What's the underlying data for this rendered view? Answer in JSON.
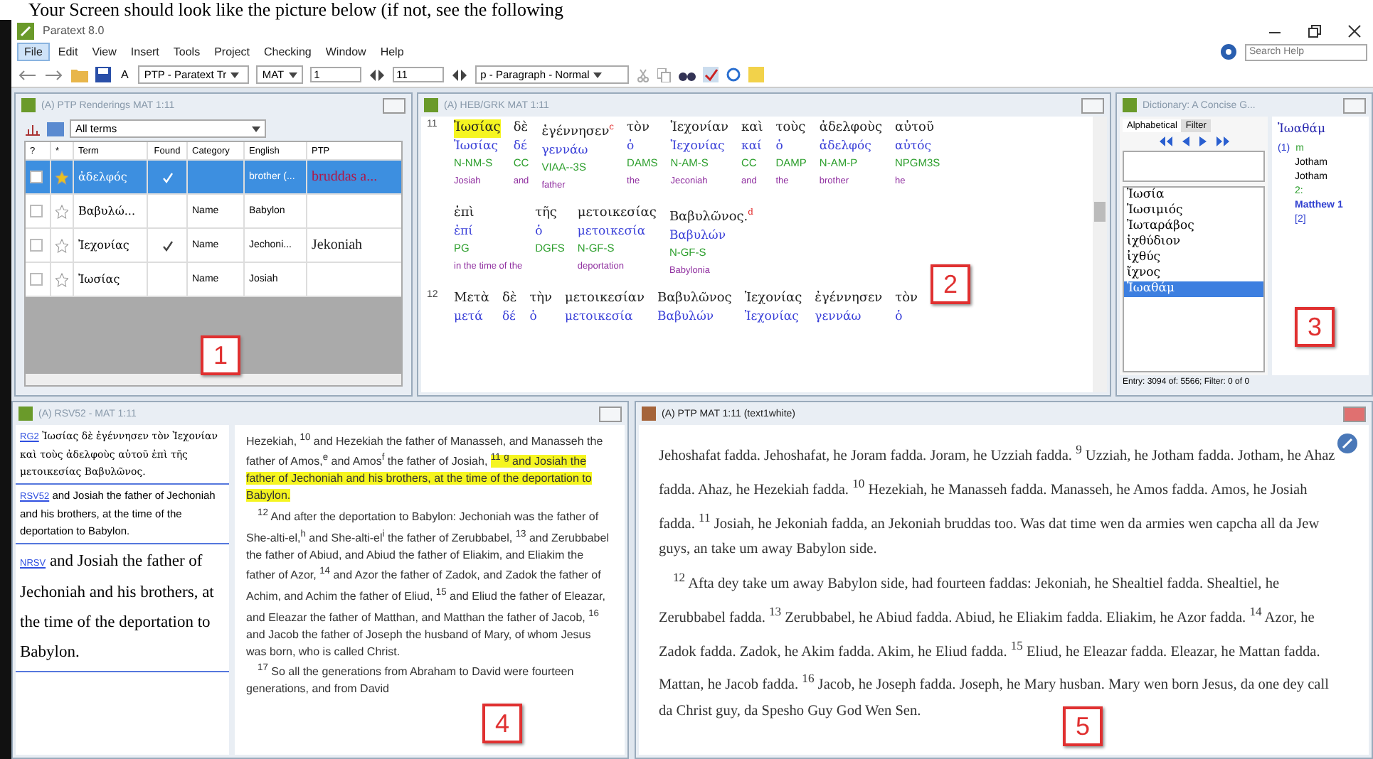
{
  "document_heading": "Your Screen should look like the picture below (if not, see the following",
  "window": {
    "title": "Paratext 8.0"
  },
  "menu": [
    {
      "label": "File",
      "selected": true
    },
    {
      "label": "Edit",
      "selected": false
    },
    {
      "label": "View",
      "selected": false
    },
    {
      "label": "Insert",
      "selected": false
    },
    {
      "label": "Tools",
      "selected": false
    },
    {
      "label": "Project",
      "selected": false
    },
    {
      "label": "Checking",
      "selected": false
    },
    {
      "label": "Window",
      "selected": false
    },
    {
      "label": "Help",
      "selected": false
    }
  ],
  "search": {
    "placeholder": "Search Help"
  },
  "toolbar": {
    "font_button": "A",
    "project": "PTP - Paratext Tr",
    "book": "MAT",
    "chapter": "1",
    "verse": "11",
    "style": "p - Paragraph - Normal"
  },
  "renderings": {
    "title": "(A) PTP Renderings MAT 1:11",
    "filter": "All terms",
    "columns": [
      "?",
      "*",
      "Term",
      "Found",
      "Category",
      "English",
      "PTP"
    ],
    "rows": [
      {
        "term": "ἀδελφός",
        "found": true,
        "starred": true,
        "english": "brother (...",
        "ptp": "bruddas a...",
        "selected": true
      },
      {
        "term": "Βαβυλώ...",
        "found": false,
        "starred": false,
        "category": "Name",
        "english": "Babylon",
        "selected": false
      },
      {
        "term": "Ἰεχονίας",
        "found": true,
        "starred": false,
        "category": "Name",
        "english": "Jechoni...",
        "ptp": "Jekoniah",
        "selected": false
      },
      {
        "term": "Ἰωσίας",
        "found": false,
        "starred": false,
        "category": "Name",
        "english": "Josiah",
        "selected": false
      }
    ]
  },
  "interlinear": {
    "title": "(A) HEB/GRK MAT 1:11",
    "lines": [
      {
        "verse": "11",
        "words": [
          {
            "text": "Ἰωσίας",
            "lemma": "Ἰωσίας",
            "parse": "N-NM-S",
            "gloss": "Josiah",
            "highlighted": true
          },
          {
            "text": "δὲ",
            "lemma": "δέ",
            "parse": "CC",
            "gloss": "and"
          },
          {
            "text": "ἐγέννησεν",
            "note": "c",
            "lemma": "γεννάω",
            "parse": "VIAA--3S",
            "gloss": "father"
          },
          {
            "text": "τὸν",
            "lemma": "ὁ",
            "parse": "DAMS",
            "gloss": "the"
          },
          {
            "text": "Ἰεχονίαν",
            "lemma": "Ἰεχονίας",
            "parse": "N-AM-S",
            "gloss": "Jeconiah"
          },
          {
            "text": "καὶ",
            "lemma": "καί",
            "parse": "CC",
            "gloss": "and"
          },
          {
            "text": "τοὺς",
            "lemma": "ὁ",
            "parse": "DAMP",
            "gloss": "the"
          },
          {
            "text": "ἀδελφοὺς",
            "lemma": "ἀδελφός",
            "parse": "N-AM-P",
            "gloss": "brother"
          },
          {
            "text": "αὐτοῦ",
            "lemma": "αὐτός",
            "parse": "NPGM3S",
            "gloss": "he"
          }
        ]
      },
      {
        "words": [
          {
            "text": "ἐπὶ",
            "lemma": "ἐπί",
            "parse": "PG",
            "gloss": "in the time of the"
          },
          {
            "text": "τῆς",
            "lemma": "ὁ",
            "parse": "DGFS"
          },
          {
            "text": "μετοικεσίας",
            "lemma": "μετοικεσία",
            "parse": "N-GF-S",
            "gloss": "deportation"
          },
          {
            "text": "Βαβυλῶνος.",
            "note": "d",
            "lemma": "Βαβυλών",
            "parse": "N-GF-S",
            "gloss": "Babylonia"
          }
        ]
      },
      {
        "verse": "12",
        "words": [
          {
            "text": "Μετὰ",
            "lemma": "μετά"
          },
          {
            "text": "δὲ",
            "lemma": "δέ"
          },
          {
            "text": "τὴν",
            "lemma": "ὁ"
          },
          {
            "text": "μετοικεσίαν",
            "lemma": "μετοικεσία"
          },
          {
            "text": "Βαβυλῶνος",
            "lemma": "Βαβυλών"
          },
          {
            "text": "Ἰεχονίας",
            "lemma": "Ἰεχονίας"
          },
          {
            "text": "ἐγέννησεν",
            "lemma": "γεννάω"
          },
          {
            "text": "τὸν",
            "lemma": "ὁ"
          }
        ]
      }
    ]
  },
  "dictionary": {
    "title": "Dictionary: A Concise G...",
    "tabs": [
      {
        "label": "Alphabetical",
        "selected": true
      },
      {
        "label": "Filter",
        "selected": false
      }
    ],
    "items": [
      {
        "text": "Ἰωσία",
        "selected": false
      },
      {
        "text": "Ἰωσιμιός",
        "selected": false
      },
      {
        "text": "Ἰωταράβος",
        "selected": false
      },
      {
        "text": "ἰχθύδιον",
        "selected": false
      },
      {
        "text": "ἰχθύς",
        "selected": false
      },
      {
        "text": "ἴχνος",
        "selected": false
      },
      {
        "text": "Ἰωαθάμ",
        "selected": true
      }
    ],
    "entry": {
      "headword": "Ἰωαθάμ",
      "sense_number": "(1)",
      "grammar": "m",
      "glosses": [
        "Jotham",
        "Jotham"
      ],
      "ref_number": "2:",
      "reference": "Matthew 1",
      "count": "[2]"
    },
    "status": "Entry: 3094 of: 5566; Filter: 0 of 0"
  },
  "resources": {
    "title": "(A) RSV52 - MAT 1:11",
    "items": [
      {
        "label": "RG2",
        "kind": "small",
        "text": "Ἰωσίας δὲ ἐγέννησεν τὸν Ἰεχονίαν καὶ τοὺς ἀδελφοὺς αὐτοῦ ἐπὶ τῆς μετοικεσίας Βαβυλῶνος."
      },
      {
        "label": "RSV52",
        "kind": "sans",
        "text": "and Josiah the father of Jechoniah and his brothers, at the time of the deportation to Babylon."
      },
      {
        "label": "NRSV",
        "kind": "large",
        "text": "and Josiah the father of Jechoniah and his brothers, at the time of the deportation to Babylon."
      }
    ],
    "paragraphs": [
      [
        {
          "text": "Hezekiah, $^{10}$ and Hezekiah the father of Manasseh, and Manasseh the father of Amos,$^{e}$ and Amos$^{f}$ the father of Josiah, ",
          "highlighted": false
        },
        {
          "text": "$^{11}$ $^{g}$ and Josiah the father of Jechoniah and his brothers, at the time of the deportation to Babylon.",
          "highlighted": true
        }
      ],
      [
        {
          "text": "$^{12}$ And after the deportation to Babylon: Jechoniah was the father of She-alti-el,$^{h}$ and She-alti-el$^{i}$ the father of Zerubbabel, $^{13}$ and Zerubbabel the father of Abiud, and Abiud the father of Eliakim, and Eliakim the father of Azor, $^{14}$ and Azor the father of Zadok, and Zadok the father of Achim, and Achim the father of Eliud, $^{15}$ and Eliud the father of Eleazar, and Eleazar the father of Matthan, and Matthan the father of Jacob, $^{16}$ and Jacob the father of Joseph the husband of Mary, of whom Jesus was born, who is called Christ.",
          "highlighted": false
        }
      ],
      [
        {
          "text": "$^{17}$ So all the generations from Abraham to David were fourteen generations, and from David",
          "highlighted": false
        }
      ]
    ]
  },
  "project_text": {
    "title": "(A) PTP MAT 1:11 (text1white)",
    "paragraphs": [
      "Jehoshafat fadda. Jehoshafat, he Joram fadda. Joram, he Uzziah fadda. $^{9}$ Uzziah, he Jotham fadda. Jotham, he Ahaz fadda. Ahaz, he Hezekiah fadda. $^{10}$ Hezekiah, he Manasseh fadda. Manasseh, he Amos fadda. Amos, he Josiah fadda. $^{11}$ Josiah, he Jekoniah fadda, an Jekoniah bruddas too. Was dat time wen da armies wen capcha all da Jew guys, an take um away Babylon side.",
      "$^{12}$ Afta dey take um away Babylon side, had fourteen faddas: Jekoniah, he Shealtiel fadda. Shealtiel, he Zerubbabel fadda. $^{13}$ Zerubbabel, he Abiud fadda. Abiud, he Eliakim fadda. Eliakim, he Azor fadda. $^{14}$ Azor, he Zadok fadda. Zadok, he Akim fadda. Akim, he Eliud fadda. $^{15}$ Eliud, he Eleazar fadda. Eleazar, he Mattan fadda. Mattan, he Jacob fadda. $^{16}$ Jacob, he Joseph fadda. Joseph, he Mary husban. Mary wen born Jesus, da one dey call da Christ guy, da Spesho Guy God Wen Sen."
    ]
  },
  "callouts": [
    "1",
    "2",
    "3",
    "4",
    "5"
  ]
}
